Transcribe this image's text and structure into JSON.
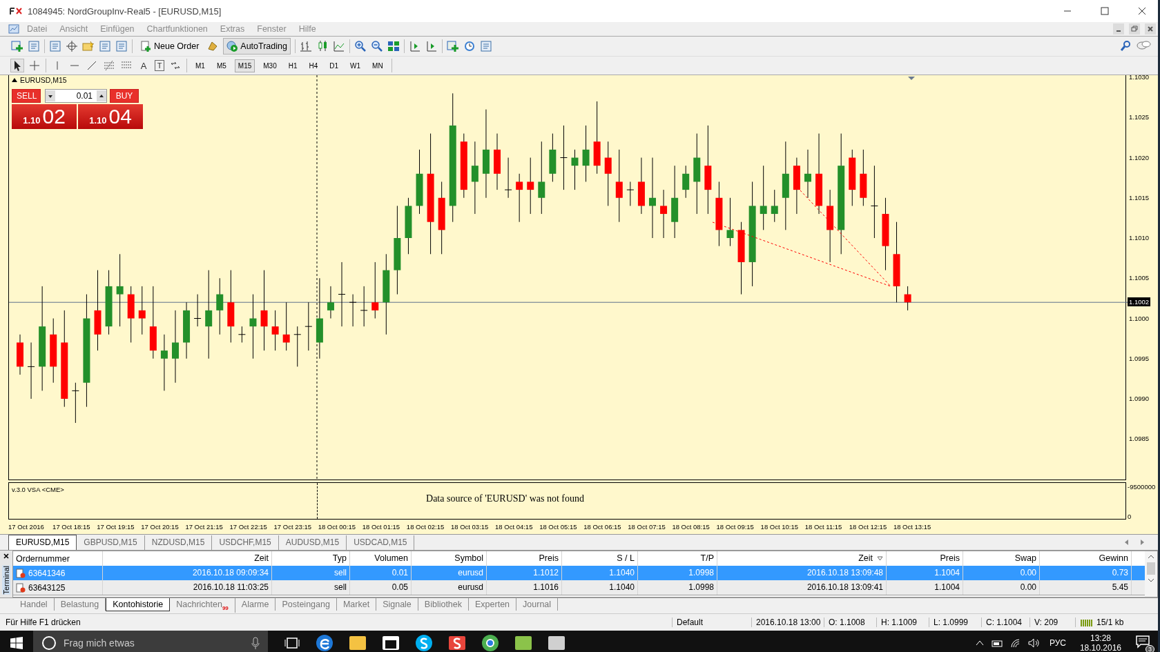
{
  "window": {
    "title": "1084945: NordGroupInv-Real5 - [EURUSD,M15]"
  },
  "menu": [
    "Datei",
    "Ansicht",
    "Einfügen",
    "Chartfunktionen",
    "Extras",
    "Fenster",
    "Hilfe"
  ],
  "toolbar": {
    "new_order": "Neue Order",
    "autotrading": {
      "label": "AutoTrading",
      "selected": true
    }
  },
  "drawing_tools": {
    "text_tool": "A",
    "label_tool": "T"
  },
  "timeframes": [
    {
      "label": "M1",
      "selected": false
    },
    {
      "label": "M5",
      "selected": false
    },
    {
      "label": "M15",
      "selected": true
    },
    {
      "label": "M30",
      "selected": false
    },
    {
      "label": "H1",
      "selected": false
    },
    {
      "label": "H4",
      "selected": false
    },
    {
      "label": "D1",
      "selected": false
    },
    {
      "label": "W1",
      "selected": false
    },
    {
      "label": "MN",
      "selected": false
    }
  ],
  "chart": {
    "symbol_label": "EURUSD,M15",
    "trade_panel": {
      "sell": "SELL",
      "buy": "BUY",
      "lot": "0.01",
      "bid_prefix": "1.10",
      "bid_pips": "02",
      "ask_prefix": "1.10",
      "ask_pips": "04"
    },
    "price_ticks": [
      "1.1030",
      "1.1025",
      "1.1020",
      "1.1015",
      "1.1010",
      "1.1005",
      "1.1000",
      "1.0995",
      "1.0990",
      "1.0985"
    ],
    "current_price": "1.1002",
    "indicator": {
      "name": "v.3.0 VSA <CME>",
      "message": "Data source of 'EURUSD' was not found",
      "ticks": [
        "-9500000",
        "0"
      ]
    },
    "time_ticks": [
      "17 Oct 2016",
      "17 Oct 18:15",
      "17 Oct 19:15",
      "17 Oct 20:15",
      "17 Oct 21:15",
      "17 Oct 22:15",
      "17 Oct 23:15",
      "18 Oct 00:15",
      "18 Oct 01:15",
      "18 Oct 02:15",
      "18 Oct 03:15",
      "18 Oct 04:15",
      "18 Oct 05:15",
      "18 Oct 06:15",
      "18 Oct 07:15",
      "18 Oct 08:15",
      "18 Oct 09:15",
      "18 Oct 10:15",
      "18 Oct 11:15",
      "18 Oct 12:15",
      "18 Oct 13:15"
    ]
  },
  "chart_tabs": [
    {
      "label": "EURUSD,M15",
      "selected": true
    },
    {
      "label": "GBPUSD,M15",
      "selected": false
    },
    {
      "label": "NZDUSD,M15",
      "selected": false
    },
    {
      "label": "USDCHF,M15",
      "selected": false
    },
    {
      "label": "AUDUSD,M15",
      "selected": false
    },
    {
      "label": "USDCAD,M15",
      "selected": false
    }
  ],
  "terminal": {
    "side_label": "Terminal",
    "columns": [
      {
        "label": "Ordernummer",
        "sorted": false
      },
      {
        "label": "Zeit",
        "sorted": false
      },
      {
        "label": "Typ",
        "sorted": false
      },
      {
        "label": "Volumen",
        "sorted": false
      },
      {
        "label": "Symbol",
        "sorted": false
      },
      {
        "label": "Preis",
        "sorted": false
      },
      {
        "label": "S / L",
        "sorted": false
      },
      {
        "label": "T/P",
        "sorted": false
      },
      {
        "label": "Zeit",
        "sorted": true
      },
      {
        "label": "Preis",
        "sorted": false
      },
      {
        "label": "Swap",
        "sorted": false
      },
      {
        "label": "Gewinn",
        "sorted": false
      }
    ],
    "rows": [
      {
        "selected": true,
        "cells": [
          "63641346",
          "2016.10.18 09:09:34",
          "sell",
          "0.01",
          "eurusd",
          "1.1012",
          "1.1040",
          "1.0998",
          "2016.10.18 13:09:48",
          "1.1004",
          "0.00",
          "0.73"
        ]
      },
      {
        "selected": false,
        "cells": [
          "63643125",
          "2016.10.18 11:03:25",
          "sell",
          "0.05",
          "eurusd",
          "1.1016",
          "1.1040",
          "1.0998",
          "2016.10.18 13:09:41",
          "1.1004",
          "0.00",
          "5.45"
        ]
      }
    ],
    "tabs": [
      {
        "label": "Handel",
        "selected": false
      },
      {
        "label": "Belastung",
        "selected": false
      },
      {
        "label": "Kontohistorie",
        "selected": true
      },
      {
        "label": "Nachrichten",
        "selected": false,
        "badge": "99"
      },
      {
        "label": "Alarme",
        "selected": false
      },
      {
        "label": "Posteingang",
        "selected": false
      },
      {
        "label": "Market",
        "selected": false
      },
      {
        "label": "Signale",
        "selected": false
      },
      {
        "label": "Bibliothek",
        "selected": false
      },
      {
        "label": "Experten",
        "selected": false
      },
      {
        "label": "Journal",
        "selected": false
      }
    ]
  },
  "status_bar": {
    "help": "Für Hilfe F1 drücken",
    "profile": "Default",
    "datetime": "2016.10.18 13:00",
    "open": "O: 1.1008",
    "high": "H: 1.1009",
    "low": "L: 1.0999",
    "close": "C: 1.1004",
    "volume": "V: 209",
    "traffic": "15/1 kb"
  },
  "taskbar": {
    "search_placeholder": "Frag mich etwas",
    "language": "РУС",
    "time": "13:28",
    "date": "18.10.2016",
    "notifications": "3"
  }
}
